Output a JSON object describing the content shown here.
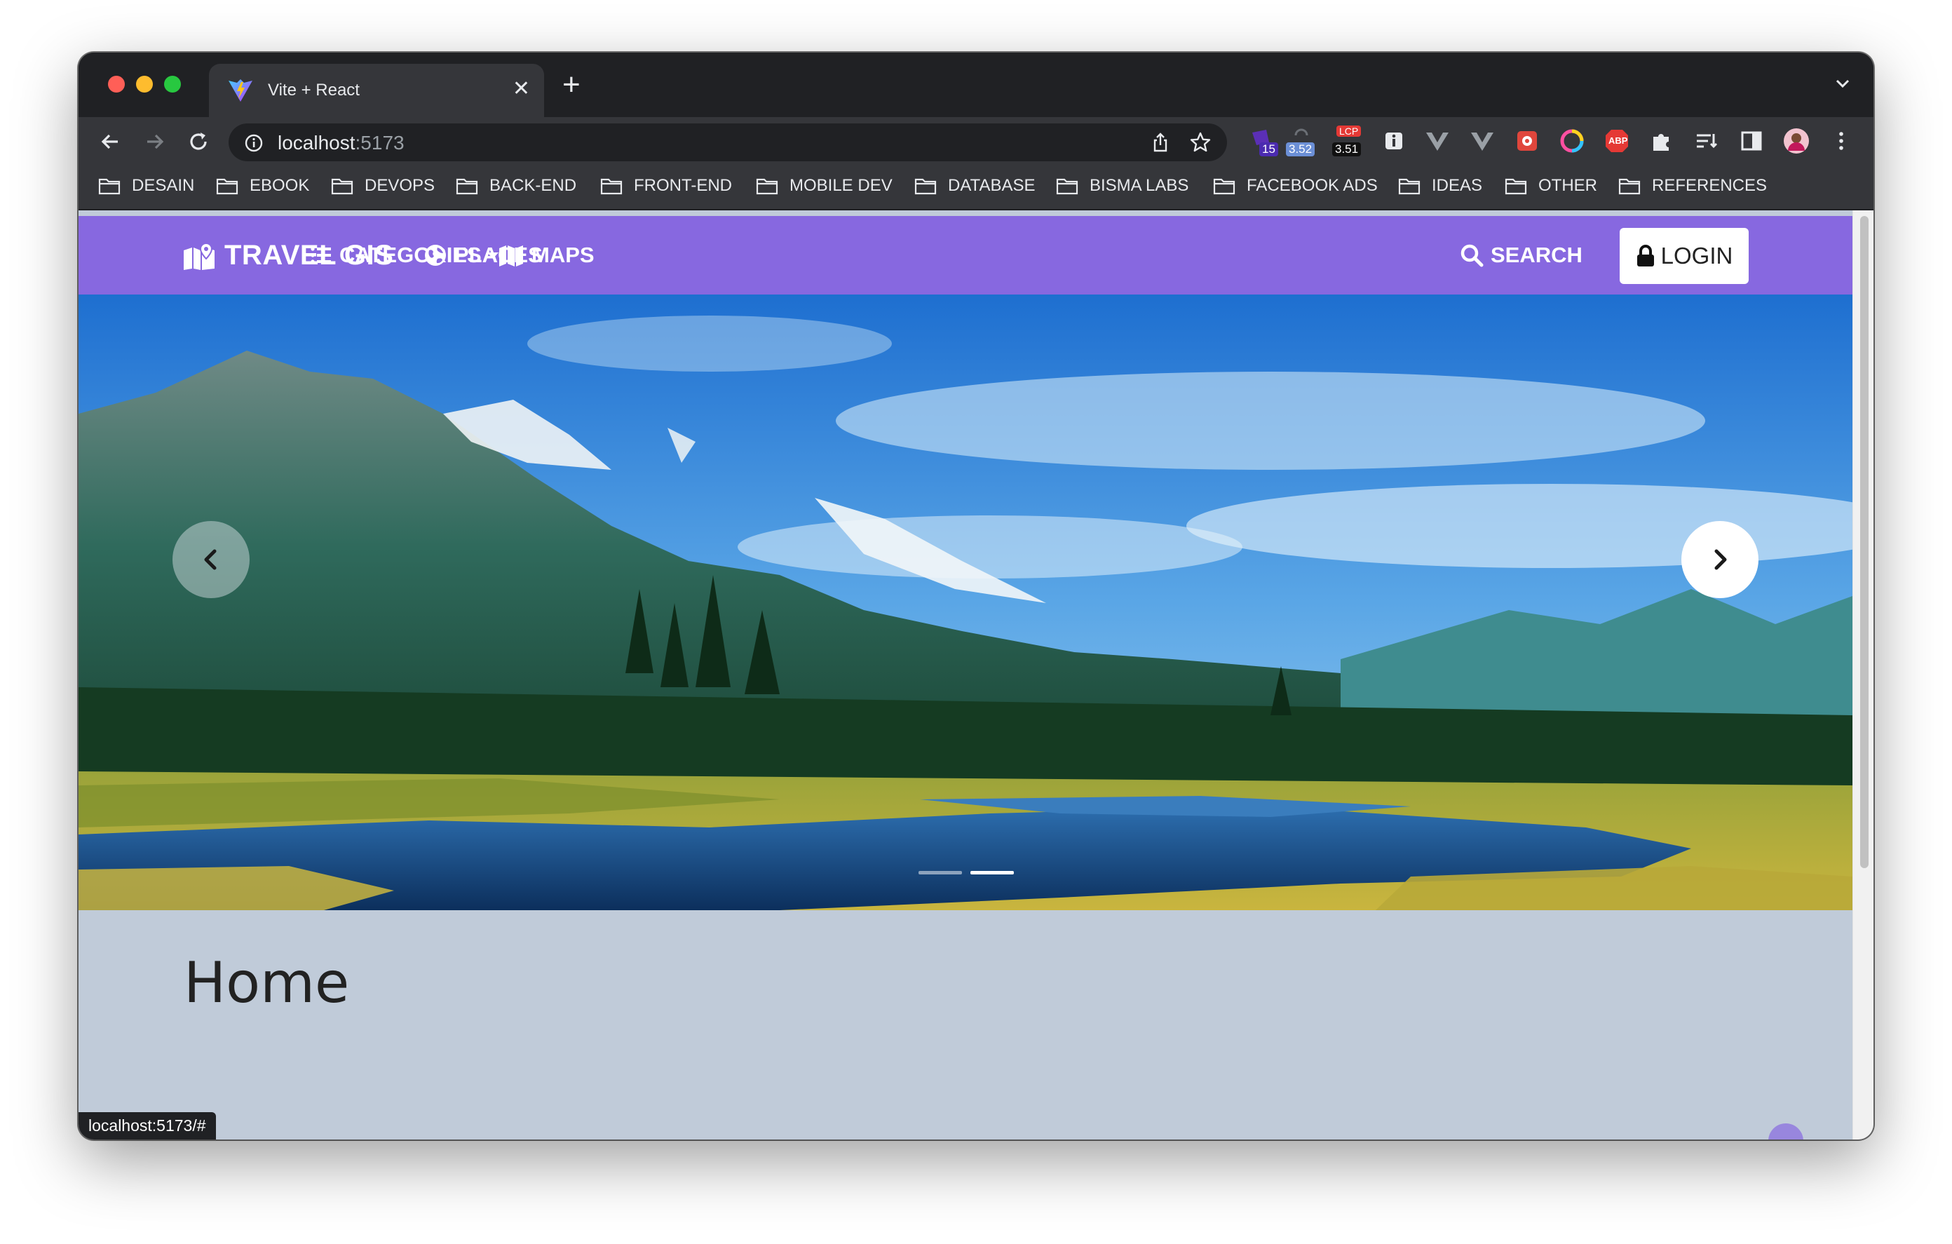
{
  "browser": {
    "tab_title": "Vite + React",
    "tab_close": "✕",
    "new_tab": "+",
    "url_host": "localhost",
    "url_port": ":5173",
    "status_url": "localhost:5173/#",
    "extensions": [
      {
        "name": "extension-badge-15",
        "badge": "15"
      },
      {
        "name": "extension-metric-352",
        "badge": "3.52"
      },
      {
        "name": "extension-lcp",
        "label": "LCP",
        "badge": "3.51"
      },
      {
        "name": "extension-info"
      },
      {
        "name": "extension-vue-devtools-1"
      },
      {
        "name": "extension-vue-devtools-2"
      },
      {
        "name": "extension-red"
      },
      {
        "name": "extension-color"
      },
      {
        "name": "extension-adblock",
        "label": "ABP"
      },
      {
        "name": "extensions-puzzle"
      },
      {
        "name": "reading-list"
      },
      {
        "name": "side-panel"
      },
      {
        "name": "profile-avatar"
      },
      {
        "name": "browser-menu"
      }
    ]
  },
  "bookmarks": [
    "DESAIN",
    "EBOOK",
    "DEVOPS",
    "BACK-END",
    "FRONT-END",
    "MOBILE DEV",
    "DATABASE",
    "BISMA LABS",
    "FACEBOOK ADS",
    "IDEAS",
    "OTHER",
    "REFERENCES"
  ],
  "navbar": {
    "brand": "TRAVEL GIS",
    "categories": "CATEGORIES",
    "places": "PLACES",
    "maps": "MAPS",
    "search": "SEARCH",
    "login": "LOGIN"
  },
  "carousel": {
    "slide_count": 2,
    "active_slide": 2
  },
  "page": {
    "heading": "Home"
  },
  "colors": {
    "navbar": "#8768e0",
    "page_bg": "#c0cbd9",
    "browser_chrome": "#35363a"
  }
}
